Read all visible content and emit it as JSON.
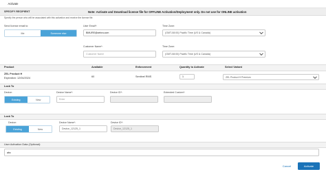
{
  "tab": {
    "label": "Activate"
  },
  "header": {
    "section_title": "SPECIFY RECIPIENT",
    "hint": "Specify the person who will be associated with this activation and receive the license file.",
    "note": "Note: Activate and Download license file for OFFLINE Activation/Deployment only. Do not use for ONLINE activation"
  },
  "recipient": {
    "send_label": "Send license email to:",
    "send_options": [
      "Me",
      "Someone else"
    ],
    "send_selected": "Someone else",
    "user_email_label": "User Email*:",
    "user_email_value": "BMURE@zebra.com",
    "customer_name_label": "Customer Name*:",
    "customer_name_placeholder": "Customer Name",
    "time_zone_label": "Time Zone:",
    "time_zone_value": "(GMT-08:00) Pacific Time (US & Canada)",
    "time_zone2_label": "Time Zone:",
    "time_zone2_value": "(GMT-08:00) Pacific Time (US & Canada)"
  },
  "product_table": {
    "headers": [
      "Product",
      "Available",
      "Enforcement",
      "Quantity to Activate",
      "Select Variant"
    ],
    "rows": [
      {
        "product": "ZEL Product H",
        "expiration": "Expiration: 12/04/2024",
        "available": "60",
        "enforcement": "Sentinel RMS",
        "quantity": "1",
        "variant": "ZEL Product H Premium"
      }
    ]
  },
  "lock_to_1": {
    "title": "Lock To",
    "device_label": "Device:",
    "device_options": [
      "Existing",
      "New"
    ],
    "device_selected": "Existing",
    "device_name_label": "Device Name*:",
    "device_name_placeholder": "Enter",
    "device_id_label": "Device ID*:",
    "device_id_value": "",
    "extended_label": "Extended Custom*:",
    "extended_value": ""
  },
  "lock_to_2": {
    "title": "Lock To",
    "device_label": "Device:",
    "device_options": [
      "Existing",
      "New"
    ],
    "device_selected": "Existing",
    "device_name_label": "Device Name*:",
    "device_name_value": "Device_12125_1",
    "device_id_label": "Device ID*:",
    "device_id_value": "Device_12125_1"
  },
  "user_activation": {
    "label": "User Activation Data (Optional):",
    "value": "abc"
  },
  "actions": {
    "cancel": "Cancel",
    "activate": "Activate"
  },
  "colors": {
    "accent": "#1a73b8",
    "segment_on": "#4aa3d8"
  }
}
